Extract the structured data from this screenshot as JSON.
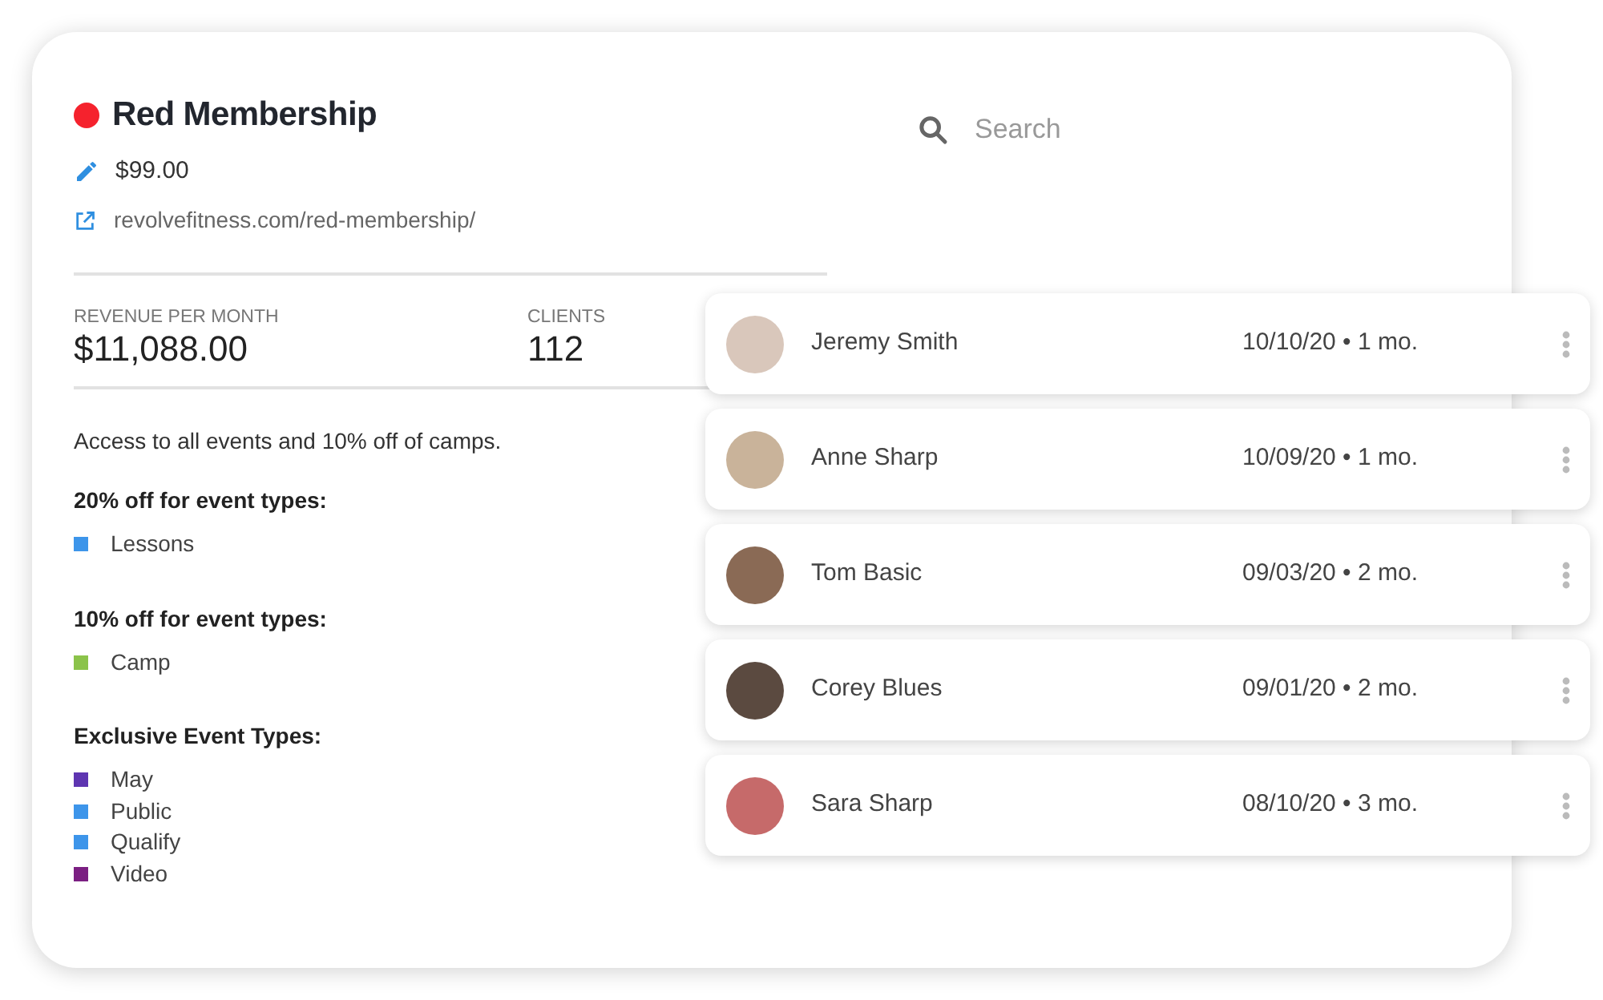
{
  "membership": {
    "title": "Red Membership",
    "color": "#f5222d",
    "price": "$99.00",
    "url": "revolvefitness.com/red-membership/"
  },
  "search": {
    "placeholder": "Search"
  },
  "stats": [
    {
      "label": "REVENUE PER MONTH",
      "value": "$11,088.00"
    },
    {
      "label": "CLIENTS",
      "value": "112"
    }
  ],
  "description": "Access to all events and 10% off of camps.",
  "groups": [
    {
      "heading": "20% off for event types:",
      "items": [
        {
          "label": "Lessons",
          "color": "#3d95ea"
        }
      ]
    },
    {
      "heading": "10% off for event types:",
      "items": [
        {
          "label": "Camp",
          "color": "#8bc34a"
        }
      ]
    },
    {
      "heading": "Exclusive Event Types:",
      "items": [
        {
          "label": "May",
          "color": "#5e35b1"
        },
        {
          "label": "Public",
          "color": "#3d95ea"
        },
        {
          "label": "Qualify",
          "color": "#3d95ea"
        },
        {
          "label": "Video",
          "color": "#7b1f82"
        }
      ]
    }
  ],
  "clients": [
    {
      "name": "Jeremy Smith",
      "date": "10/10/20 • 1 mo."
    },
    {
      "name": "Anne Sharp",
      "date": "10/09/20 • 1 mo."
    },
    {
      "name": "Tom Basic",
      "date": "09/03/20 • 2 mo."
    },
    {
      "name": "Corey Blues",
      "date": "09/01/20 • 2 mo."
    },
    {
      "name": "Sara Sharp",
      "date": "08/10/20 • 3 mo."
    }
  ]
}
